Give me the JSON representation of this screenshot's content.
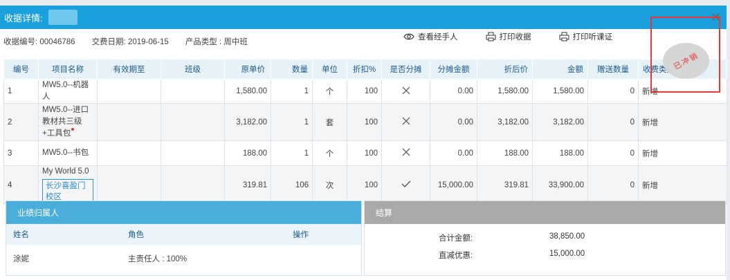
{
  "dialog": {
    "title": "收据详情:",
    "close_label": "✕"
  },
  "info": {
    "receipt_no": "收据编号: 00046786",
    "pay_date": "交费日期: 2019-06-15",
    "product_type": "产品类型 : 周中班"
  },
  "actions": {
    "view_handler": "查看经手人",
    "print_receipt": "打印收据",
    "print_class_cert": "打印听课证"
  },
  "stamp": {
    "text": "已冲销",
    "color": "#e53935"
  },
  "table": {
    "headers": [
      "编号",
      "项目名称",
      "有效期至",
      "班级",
      "原单价",
      "数量",
      "单位",
      "折扣%",
      "是否分摊",
      "分摊金额",
      "折后价",
      "金额",
      "赠送数量",
      "收费类型"
    ],
    "rows": [
      {
        "no": "1",
        "name": "MW5.0--机器人",
        "expire": "",
        "class": "",
        "price": "1,580.00",
        "qty": "1",
        "unit": "个",
        "discount": "100",
        "split": "no",
        "split_amount": "0.00",
        "after": "1,580.00",
        "amount": "1,580.00",
        "gift": "0",
        "type": "新增"
      },
      {
        "no": "2",
        "name": "MW5.0--进口教材共三级+工具包",
        "expire": "",
        "class": "",
        "price": "3,182.00",
        "qty": "1",
        "unit": "套",
        "discount": "100",
        "split": "no",
        "split_amount": "0.00",
        "after": "3,182.00",
        "amount": "3,182.00",
        "gift": "0",
        "type": "新增"
      },
      {
        "no": "3",
        "name": "MW5.0--书包",
        "expire": "",
        "class": "",
        "price": "188.00",
        "qty": "1",
        "unit": "个",
        "discount": "100",
        "split": "no",
        "split_amount": "0.00",
        "after": "188.00",
        "amount": "188.00",
        "gift": "0",
        "type": "新增"
      },
      {
        "no": "4",
        "name": "My World 5.0",
        "campus": "长沙喜盈门校区",
        "expire": "",
        "class": "",
        "price": "319.81",
        "qty": "106",
        "unit": "次",
        "discount": "100",
        "split": "yes",
        "split_amount": "15,000.00",
        "after": "319.81",
        "amount": "33,900.00",
        "gift": "0",
        "type": "新增"
      }
    ]
  },
  "performance": {
    "title": "业绩归属人",
    "headers": {
      "name": "姓名",
      "role": "角色",
      "op": "操作"
    },
    "rows": [
      {
        "name": "涂妮",
        "role": "主责任人 : 100%"
      }
    ]
  },
  "settlement": {
    "title": "结算",
    "total_label": "合计金额:",
    "total_value": "38,850.00",
    "discount_label": "直减优惠:",
    "discount_value": "15,000.00"
  },
  "colors": {
    "title_bar": "#1aa0dc",
    "perf_header": "#4aaedb",
    "settle_header": "#a9a9a9",
    "annotation_box": "#e53935"
  }
}
